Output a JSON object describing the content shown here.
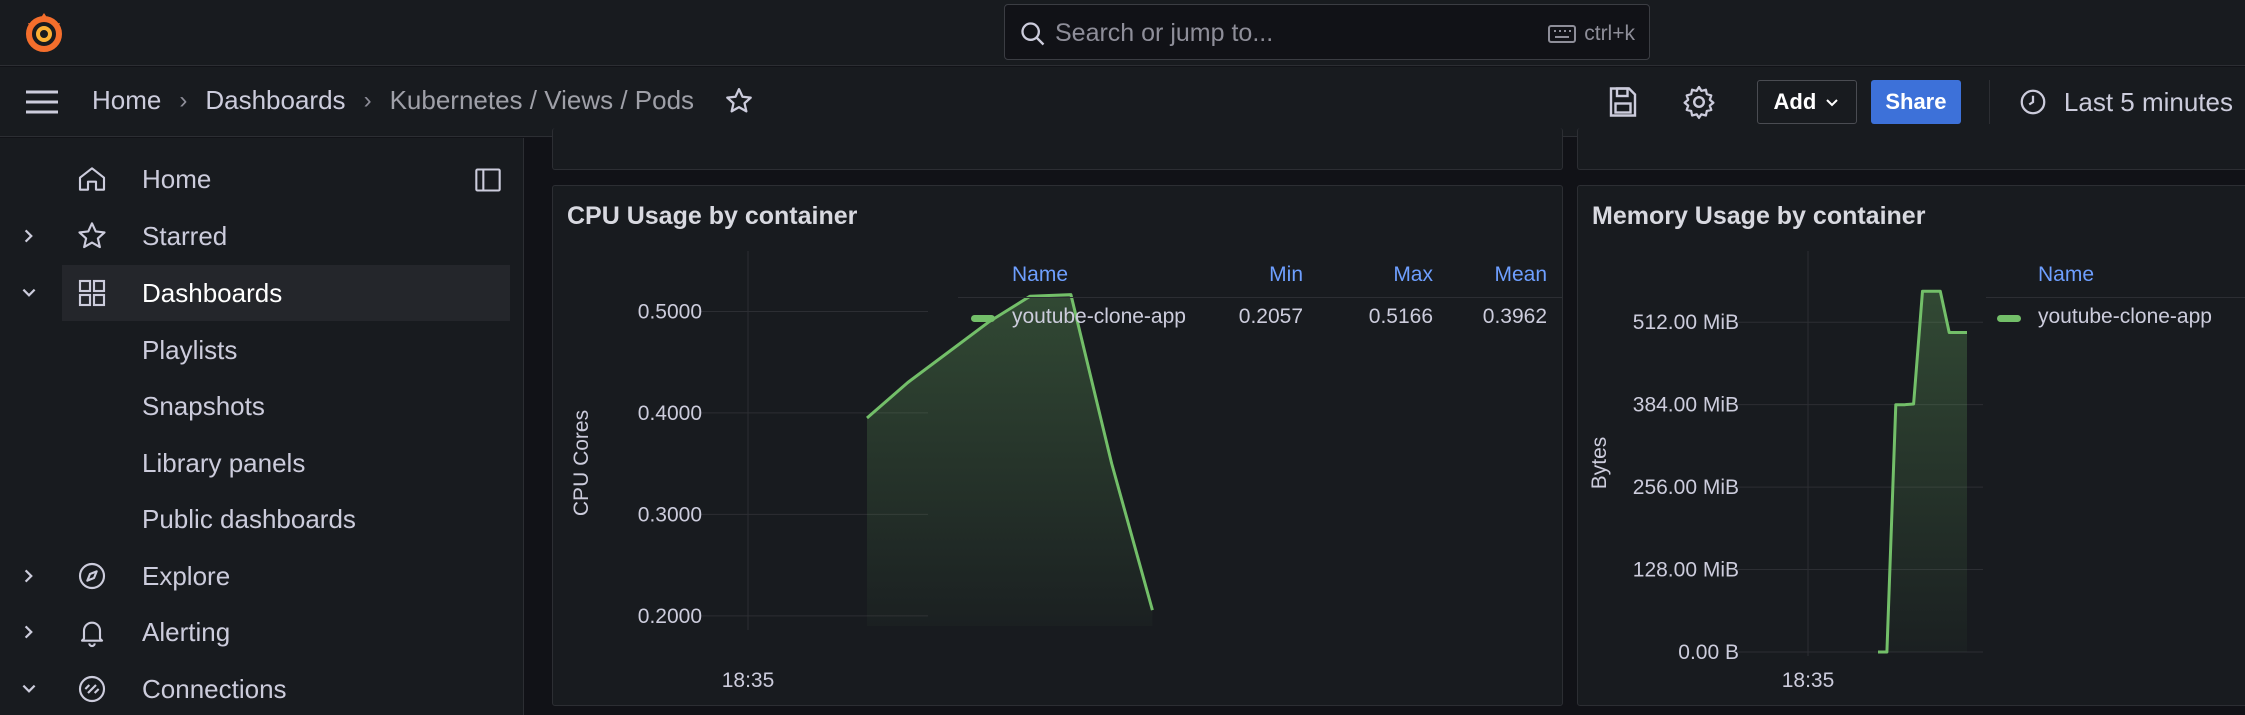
{
  "search": {
    "placeholder": "Search or jump to...",
    "shortcut": "ctrl+k"
  },
  "breadcrumb": {
    "home": "Home",
    "dashboards": "Dashboards",
    "current": "Kubernetes / Views / Pods"
  },
  "toolbar": {
    "add_label": "Add",
    "share_label": "Share",
    "time_range": "Last 5 minutes"
  },
  "sidebar": {
    "items": [
      {
        "label": "Home",
        "icon": "home-icon"
      },
      {
        "label": "Starred",
        "icon": "star-icon"
      },
      {
        "label": "Dashboards",
        "icon": "grid-icon"
      },
      {
        "label": "Playlists"
      },
      {
        "label": "Snapshots"
      },
      {
        "label": "Library panels"
      },
      {
        "label": "Public dashboards"
      },
      {
        "label": "Explore",
        "icon": "compass-icon"
      },
      {
        "label": "Alerting",
        "icon": "bell-icon"
      },
      {
        "label": "Connections",
        "icon": "connections-icon"
      }
    ]
  },
  "colors": {
    "accent": "#f46e2c",
    "series": "#73bf69",
    "share": "#3d71d9",
    "legend_head": "#6e9fff"
  },
  "chart_data": [
    {
      "type": "line",
      "title": "CPU Usage by container",
      "ylabel": "CPU Cores",
      "xlabel": "",
      "x_ticks": [
        "18:35"
      ],
      "y_ticks": [
        "0.2000",
        "0.3000",
        "0.4000",
        "0.5000"
      ],
      "ylim": [
        0.19,
        0.53
      ],
      "legend": {
        "columns": [
          "Name",
          "Min",
          "Max",
          "Mean"
        ],
        "rows": [
          {
            "name": "youtube-clone-app",
            "min": "0.2057",
            "max": "0.5166",
            "mean": "0.3962"
          }
        ]
      },
      "series": [
        {
          "name": "youtube-clone-app",
          "x": [
            0,
            1,
            2,
            3,
            4,
            5,
            6,
            7
          ],
          "values": [
            0.395,
            0.43,
            0.46,
            0.49,
            0.515,
            0.5166,
            0.35,
            0.2057
          ]
        }
      ],
      "x_domain": [
        0,
        18
      ]
    },
    {
      "type": "line",
      "title": "Memory Usage by container",
      "ylabel": "Bytes",
      "xlabel": "",
      "x_ticks": [
        "18:35"
      ],
      "y_ticks": [
        "0.00 B",
        "128.00 MiB",
        "256.00 MiB",
        "384.00 MiB",
        "512.00 MiB"
      ],
      "ylim": [
        0,
        576
      ],
      "legend": {
        "columns": [
          "Name"
        ],
        "rows": [
          {
            "name": "youtube-clone-app"
          }
        ]
      },
      "series": [
        {
          "name": "youtube-clone-app",
          "x": [
            0,
            1,
            2,
            3,
            4,
            5,
            6,
            7,
            8,
            9,
            10
          ],
          "values": [
            0,
            0,
            384,
            384,
            385,
            560,
            560,
            560,
            496,
            496,
            496
          ]
        }
      ],
      "x_domain": [
        0,
        10
      ]
    }
  ]
}
